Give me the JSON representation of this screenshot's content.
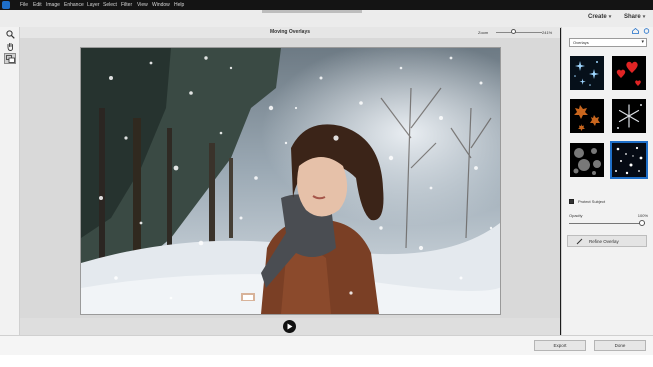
{
  "menubar": {
    "items": [
      "File",
      "Edit",
      "Image",
      "Enhance",
      "Layer",
      "Select",
      "Filter",
      "View",
      "Window",
      "Help"
    ]
  },
  "toolbar": {
    "create_label": "Create",
    "share_label": "Share"
  },
  "tools": [
    "zoom-tool",
    "hand-tool",
    "overlay-tool"
  ],
  "canvas": {
    "title": "Moving Overlays",
    "zoom_label": "Zoom",
    "zoom_value": "241%",
    "zoom_fraction": 0.4
  },
  "panel": {
    "dropdown_value": "Overlays",
    "overlays": [
      {
        "name": "sparkle-stars",
        "selected": false
      },
      {
        "name": "red-hearts",
        "selected": false
      },
      {
        "name": "autumn-leaves",
        "selected": false
      },
      {
        "name": "snowflakes",
        "selected": false
      },
      {
        "name": "bokeh-circles",
        "selected": false
      },
      {
        "name": "falling-snow",
        "selected": true
      }
    ],
    "protect_subject_label": "Protect Subject",
    "opacity_label": "Opacity",
    "opacity_value": "100%",
    "opacity_fraction": 1.0,
    "refine_label": "Refine Overlay"
  },
  "footer": {
    "export_label": "Export",
    "done_label": "Done"
  },
  "colors": {
    "accent": "#1f6fc9",
    "menubar": "#141414"
  }
}
